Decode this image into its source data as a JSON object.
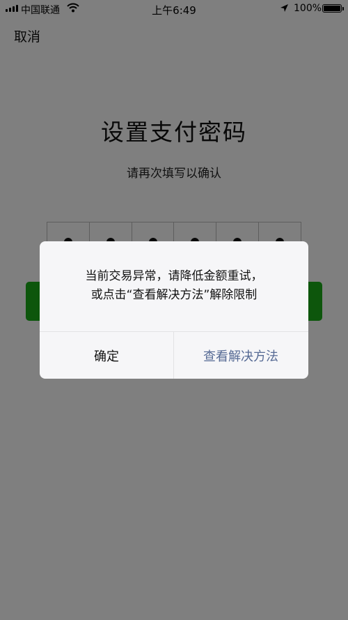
{
  "status_bar": {
    "carrier": "中国联通",
    "time": "上午6:49",
    "battery": "100%",
    "icons": [
      "signal-icon",
      "wifi-icon",
      "location-arrow-icon",
      "battery-icon"
    ]
  },
  "header": {
    "cancel_label": "取消"
  },
  "main": {
    "title": "设置支付密码",
    "subtitle": "请再次填写以确认",
    "pin_filled_count": 6
  },
  "dialog": {
    "message_line1": "当前交易异常，请降低金额重试，",
    "message_line2": "或点击“查看解决方法”解除限制",
    "ok_label": "确定",
    "solution_label": "查看解决方法"
  },
  "colors": {
    "link": "#576b95",
    "primary_green": "#1aad19",
    "overlay": "rgba(0,0,0,0.5)"
  }
}
